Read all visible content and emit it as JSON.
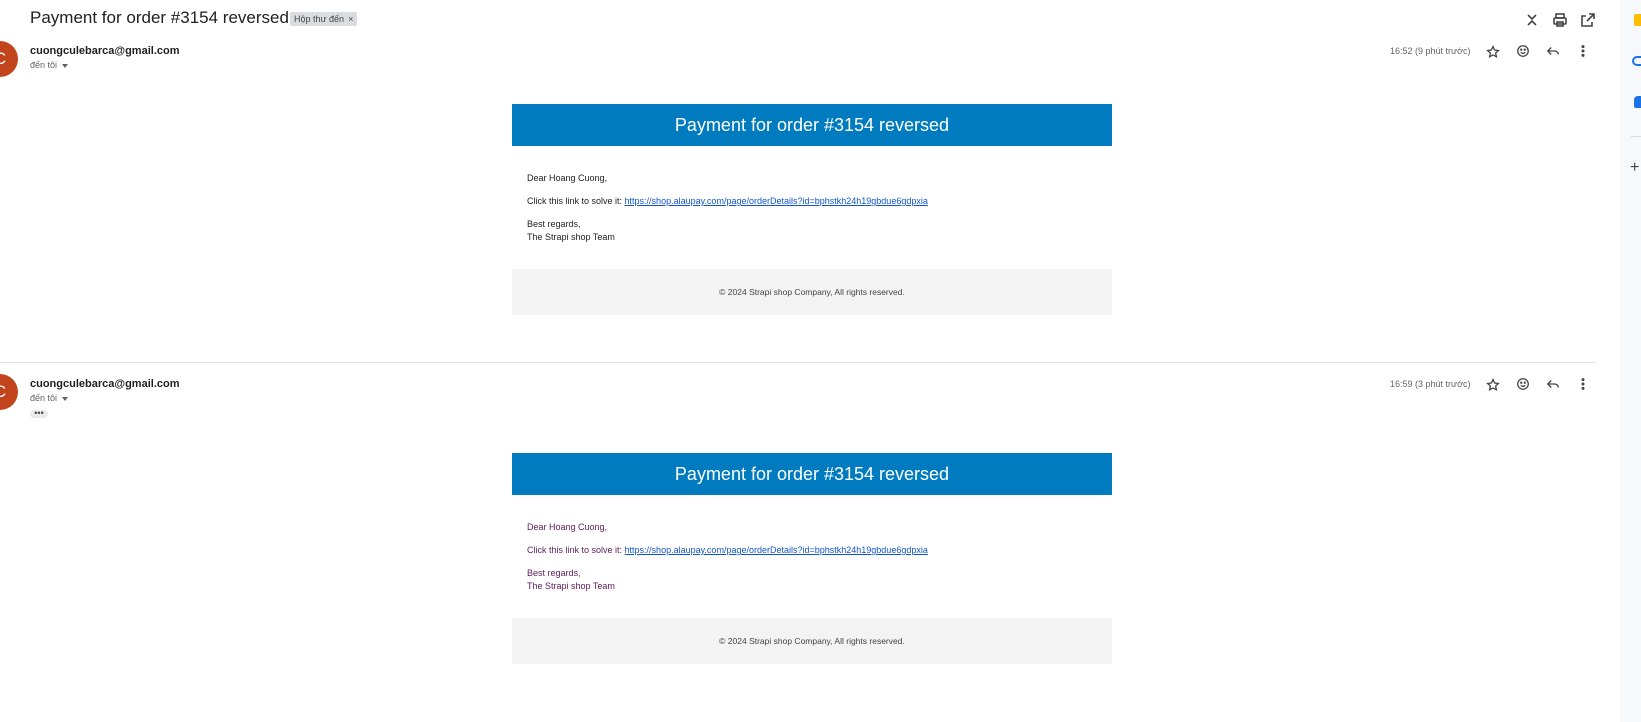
{
  "subject": "Payment for order #3154 reversed",
  "label_chip": "Hộp thư đến",
  "messages": [
    {
      "avatar_letter": "C",
      "sender": "cuongculebarca@gmail.com",
      "to_me": "đến tôi",
      "time": "16:52 (9 phút trước)",
      "banner": "Payment for order #3154 reversed",
      "greeting": "Dear Hoang Cuong,",
      "link_prefix": "Click this link to solve it:",
      "link_text": "https://shop.alaupay.com/page/orderDetails?id=bphstkh24h19gbdue6gdpxia",
      "regards": "Best regards,",
      "team": "The Strapi shop Team",
      "footer": "© 2024 Strapi shop Company, All rights reserved."
    },
    {
      "avatar_letter": "C",
      "sender": "cuongculebarca@gmail.com",
      "to_me": "đến tôi",
      "time": "16:59 (3 phút trước)",
      "banner": "Payment for order #3154 reversed",
      "greeting": "Dear Hoang Cuong,",
      "link_prefix": "Click this link to solve it:",
      "link_text": "https://shop.alaupay.com/page/orderDetails?id=bphstkh24h19gbdue6gdpxia",
      "regards": "Best regards,",
      "team": "The Strapi shop Team",
      "footer": "© 2024 Strapi shop Company, All rights reserved."
    }
  ],
  "trimmed_content": "•••",
  "colors": {
    "banner": "#007bbf",
    "avatar": "#c1441c",
    "link": "#1155cc",
    "quoted_text": "#5c1a5c"
  },
  "icons": {
    "top": [
      "collapse-all-icon",
      "print-icon",
      "open-new-window-icon"
    ],
    "message": [
      "star-icon",
      "emoji-icon",
      "reply-icon",
      "more-vert-icon"
    ],
    "rail": [
      "keep-icon",
      "tasks-icon",
      "contacts-icon",
      "add-icon"
    ]
  }
}
